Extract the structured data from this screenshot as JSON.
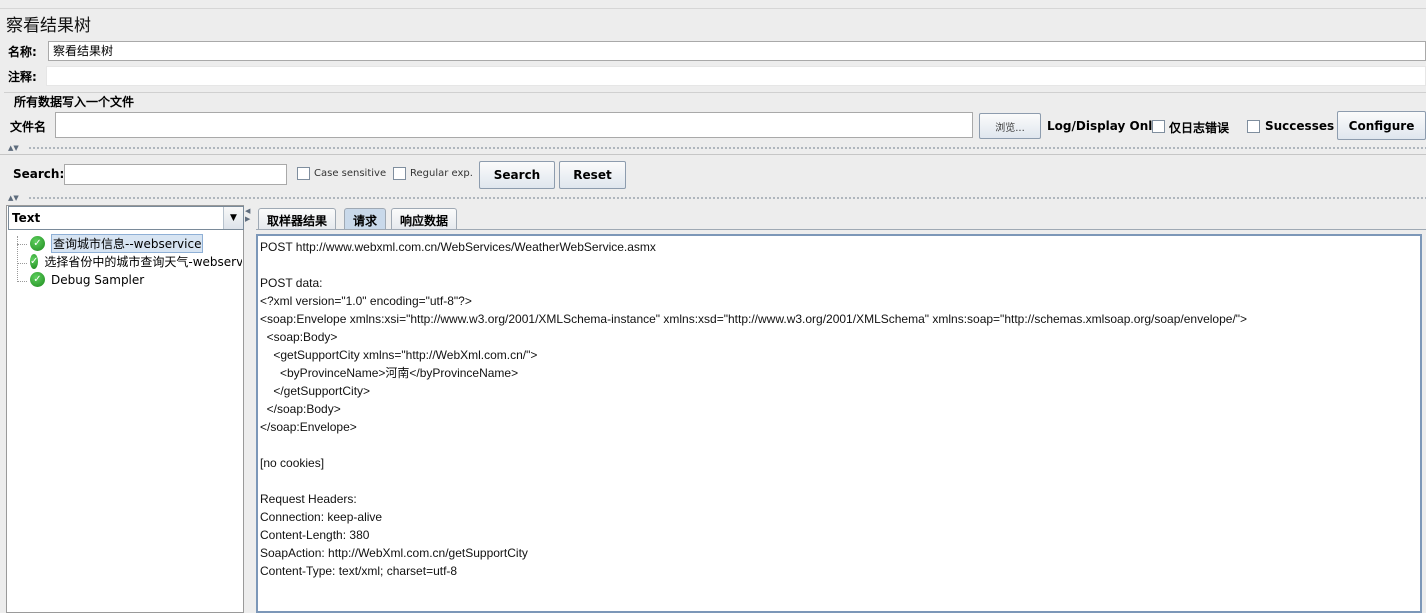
{
  "window": {
    "title": "察看结果树"
  },
  "form": {
    "name_label": "名称:",
    "name_value": "察看结果树",
    "comment_label": "注释:",
    "comment_value": ""
  },
  "file_group": {
    "legend": "所有数据写入一个文件",
    "filename_label": "文件名",
    "filename_value": "",
    "browse_label": "浏览...",
    "log_display_label": "Log/Display Only:",
    "errors_only_label": "仅日志错误",
    "successes_label": "Successes",
    "configure_label": "Configure"
  },
  "search": {
    "label": "Search:",
    "value": "",
    "case_sensitive_label": "Case sensitive",
    "regex_label": "Regular exp.",
    "search_button": "Search",
    "reset_button": "Reset"
  },
  "renderer_combo": {
    "selected": "Text"
  },
  "tree": {
    "items": [
      {
        "label": "查询城市信息--webservice",
        "status": "success",
        "selected": true
      },
      {
        "label": "选择省份中的城市查询天气-webservice",
        "status": "success",
        "selected": false
      },
      {
        "label": "Debug Sampler",
        "status": "success",
        "selected": false
      }
    ]
  },
  "tabs": [
    {
      "label": "取样器结果",
      "active": false
    },
    {
      "label": "请求",
      "active": true
    },
    {
      "label": "响应数据",
      "active": false
    }
  ],
  "request_content": {
    "lines": [
      "POST http://www.webxml.com.cn/WebServices/WeatherWebService.asmx",
      "",
      "POST data:",
      "<?xml version=\"1.0\" encoding=\"utf-8\"?>",
      "<soap:Envelope xmlns:xsi=\"http://www.w3.org/2001/XMLSchema-instance\" xmlns:xsd=\"http://www.w3.org/2001/XMLSchema\" xmlns:soap=\"http://schemas.xmlsoap.org/soap/envelope/\">",
      "  <soap:Body>",
      "    <getSupportCity xmlns=\"http://WebXml.com.cn/\">",
      "      <byProvinceName>河南</byProvinceName>",
      "    </getSupportCity>",
      "  </soap:Body>",
      "</soap:Envelope>",
      "",
      "[no cookies]",
      "",
      "Request Headers:",
      "Connection: keep-alive",
      "Content-Length: 380",
      "SoapAction: http://WebXml.com.cn/getSupportCity",
      "Content-Type: text/xml; charset=utf-8"
    ]
  },
  "colors": {
    "background": "#ededed",
    "selection": "#d7e4f2",
    "success_icon": "#2ea52e",
    "active_tab": "#c9d9ea"
  },
  "icons": {
    "tree_status": "check-shield-icon",
    "combo_arrow": "chevron-down-icon"
  }
}
